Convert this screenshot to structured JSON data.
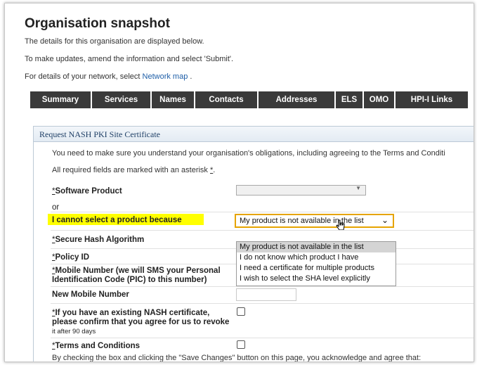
{
  "page": {
    "title": "Organisation snapshot",
    "intro_line1": "The details for this organisation are displayed below.",
    "intro_line2": "To make updates, amend the information and select 'Submit'.",
    "intro_line3_prefix": "For details of your network, select",
    "network_map_link": "Network map",
    "intro_line3_suffix": "."
  },
  "tabs": [
    "Summary",
    "Services",
    "Names",
    "Contacts",
    "Addresses",
    "ELS",
    "OMO",
    "HPI-I Links"
  ],
  "panel": {
    "heading": "Request NASH PKI Site Certificate",
    "notice": "You need to make sure you understand your organisation's obligations, including agreeing to the Terms and Conditi",
    "required_note": "All required fields are marked with an asterisk",
    "required_star": "*",
    "required_suffix": "."
  },
  "form": {
    "software_product_label": "Software Product",
    "or_label": "or",
    "cannot_select_label": "I cannot select a product because",
    "cannot_select_value": "My product is not available in the list",
    "cannot_select_options": [
      "My product is not available in the list",
      "I do not know which product I have",
      "I need a certificate for multiple products",
      "I wish to select the SHA level explicitly"
    ],
    "hash_label": "Secure Hash Algorithm",
    "policy_label": "Policy ID",
    "mobile_label_line1": "Mobile Number (we will SMS your Personal",
    "mobile_label_line2": "Identification Code (PIC) to this number)",
    "new_mobile_label": "New Mobile Number",
    "existing_cert_line1": "If you have an existing NASH certificate,",
    "existing_cert_line2": "please confirm that you agree for us to revoke",
    "existing_cert_line3": "it after 90 days",
    "terms_label": "Terms and Conditions",
    "terms_text": "By checking the box and clicking the \"Save Changes\" button on this page, you acknowledge and agree that:",
    "star": "*"
  }
}
